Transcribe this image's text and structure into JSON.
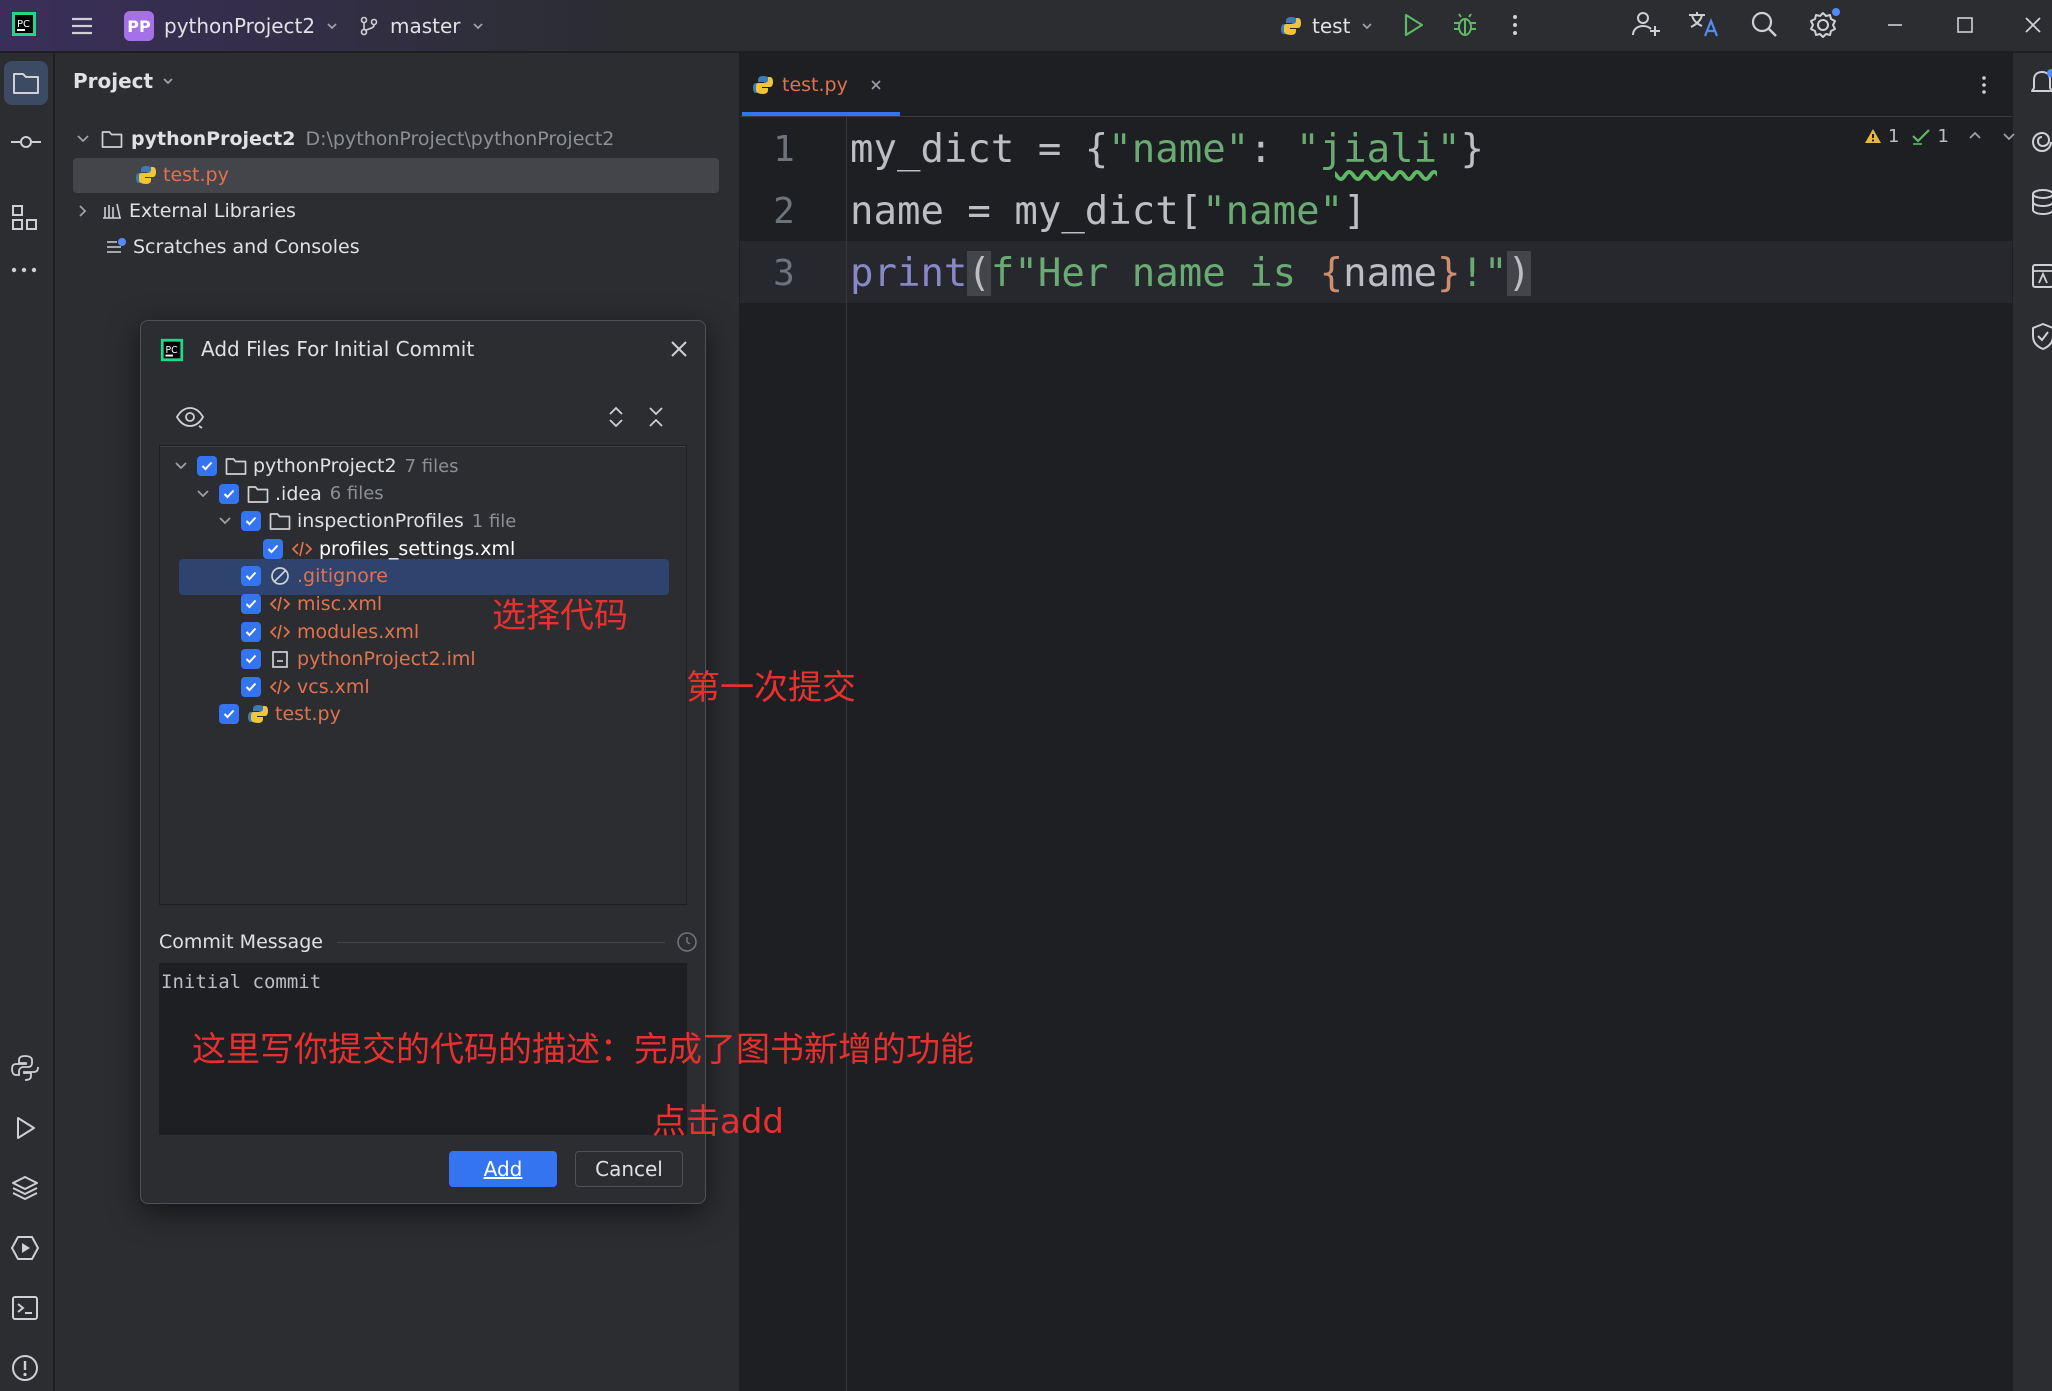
{
  "titlebar": {
    "project_badge": "PP",
    "project_name": "pythonProject2",
    "branch": "master",
    "run_config": "test"
  },
  "project_panel": {
    "title": "Project",
    "tree": [
      {
        "label": "pythonProject2",
        "path": "D:\\pythonProject\\pythonProject2"
      },
      {
        "label": "test.py"
      },
      {
        "label": "External Libraries"
      },
      {
        "label": "Scratches and Consoles"
      }
    ]
  },
  "editor": {
    "tab_label": "test.py",
    "line_numbers": [
      "1",
      "2",
      "3"
    ],
    "inspection": {
      "warnings": "1",
      "ok": "1"
    },
    "lines": [
      {
        "tokens": [
          {
            "t": "my_dict = {",
            "c": "#bcbec4"
          },
          {
            "t": "\"name\"",
            "c": "#6aab73"
          },
          {
            "t": ": ",
            "c": "#bcbec4"
          },
          {
            "t": "\"",
            "c": "#6aab73"
          },
          {
            "t": "jiali",
            "c": "#6aab73",
            "u": true
          },
          {
            "t": "\"",
            "c": "#6aab73"
          },
          {
            "t": "}",
            "c": "#bcbec4"
          }
        ]
      },
      {
        "tokens": [
          {
            "t": "name = my_dict[",
            "c": "#bcbec4"
          },
          {
            "t": "\"name\"",
            "c": "#6aab73"
          },
          {
            "t": "]",
            "c": "#bcbec4"
          }
        ]
      },
      {
        "tokens": [
          {
            "t": "print",
            "c": "#8888c6"
          },
          {
            "t": "(",
            "c": "#bcbec4",
            "hl": true
          },
          {
            "t": "f\"Her name is ",
            "c": "#6aab73"
          },
          {
            "t": "{",
            "c": "#cf8e6d"
          },
          {
            "t": "name",
            "c": "#bcbec4"
          },
          {
            "t": "}",
            "c": "#cf8e6d"
          },
          {
            "t": "!\"",
            "c": "#6aab73"
          },
          {
            "t": ")",
            "c": "#bcbec4",
            "hl": true
          }
        ]
      }
    ]
  },
  "dialog": {
    "title": "Add Files For Initial Commit",
    "files": [
      {
        "label": "pythonProject2",
        "count": "7 files",
        "kind": "folder",
        "depth": 0
      },
      {
        "label": ".idea",
        "count": "6 files",
        "kind": "folder",
        "depth": 1
      },
      {
        "label": "inspectionProfiles",
        "count": "1 file",
        "kind": "folder",
        "depth": 2
      },
      {
        "label": "profiles_settings.xml",
        "count": "",
        "kind": "xml",
        "depth": 3
      },
      {
        "label": ".gitignore",
        "count": "",
        "kind": "ignore",
        "depth": 2
      },
      {
        "label": "misc.xml",
        "count": "",
        "kind": "xml",
        "depth": 2
      },
      {
        "label": "modules.xml",
        "count": "",
        "kind": "xml",
        "depth": 2
      },
      {
        "label": "pythonProject2.iml",
        "count": "",
        "kind": "iml",
        "depth": 2
      },
      {
        "label": "vcs.xml",
        "count": "",
        "kind": "xml",
        "depth": 2
      },
      {
        "label": "test.py",
        "count": "",
        "kind": "py",
        "depth": 1
      }
    ],
    "commit_message_label": "Commit Message",
    "commit_message": "Initial commit",
    "add_label": "Add",
    "cancel_label": "Cancel"
  },
  "annotations": {
    "select_code": "选择代码",
    "first_commit": "第一次提交",
    "describe": "这里写你提交的代码的描述：完成了图书新增的功能",
    "click_add": "点击add"
  },
  "colors": {
    "accent": "#3574f0",
    "annotation": "#e8312f",
    "string": "#6aab73",
    "keyword": "#cf8e6d"
  }
}
